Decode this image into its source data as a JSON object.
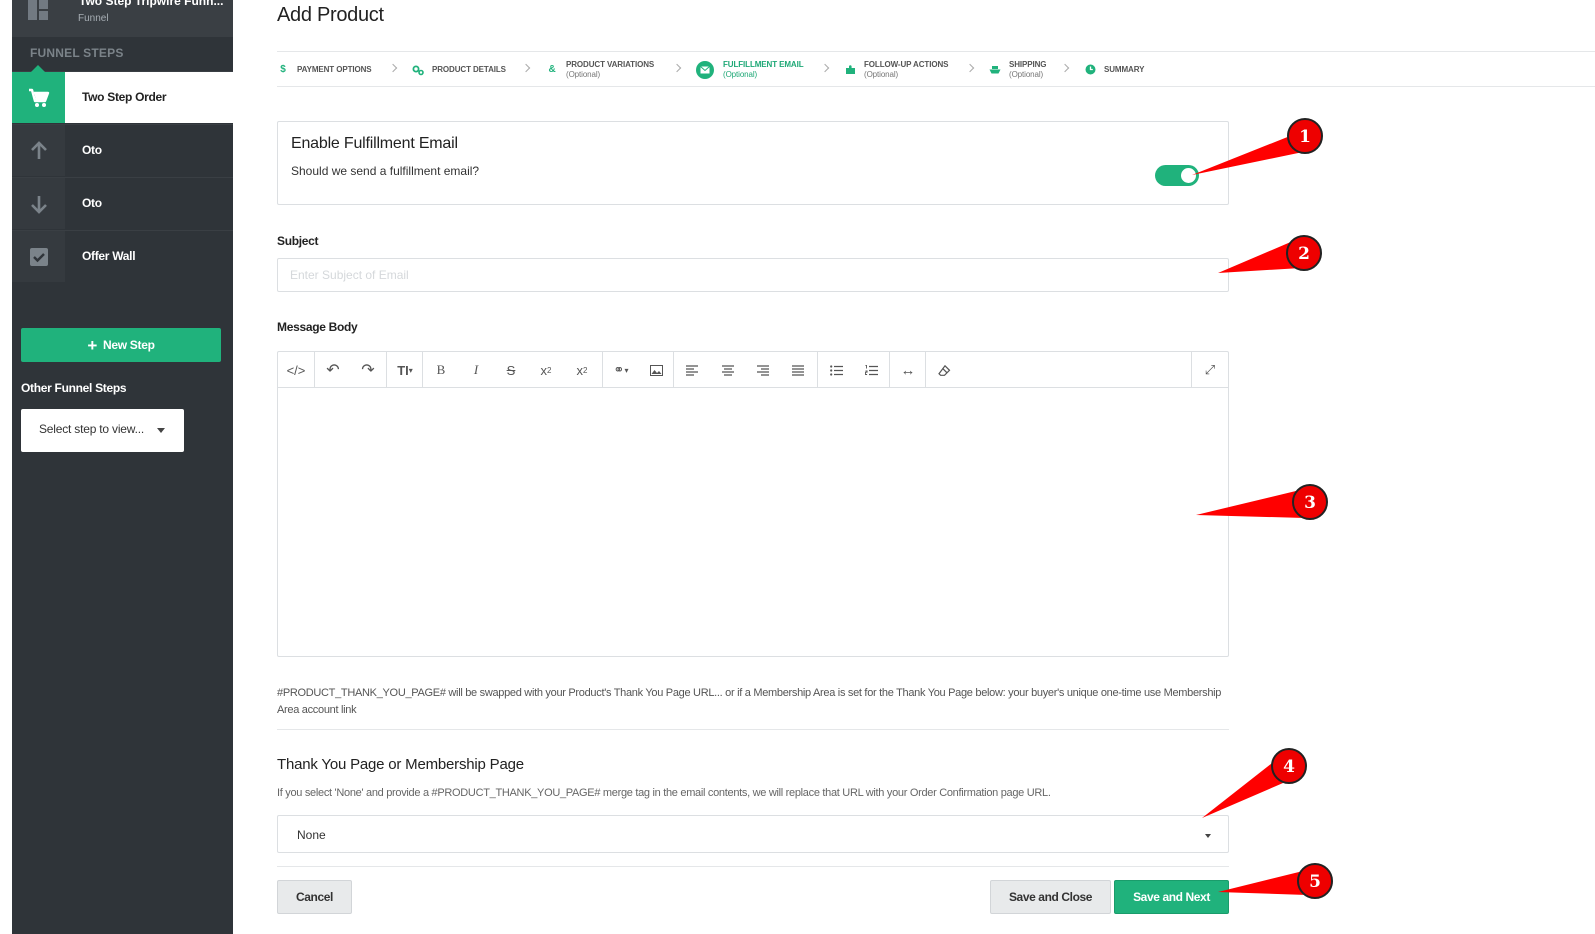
{
  "sidebar": {
    "funnel_title": "Two Step Tripwire Funn...",
    "funnel_subtitle": "Funnel",
    "steps_label": "FUNNEL STEPS",
    "steps": [
      {
        "label": "Two Step Order",
        "icon": "cart-icon",
        "active": true
      },
      {
        "label": "Oto",
        "icon": "arrow-up-icon",
        "active": false
      },
      {
        "label": "Oto",
        "icon": "arrow-down-icon",
        "active": false
      },
      {
        "label": "Offer Wall",
        "icon": "checkbox-icon",
        "active": false
      }
    ],
    "new_step_label": "New Step",
    "other_label": "Other Funnel Steps",
    "select_placeholder": "Select step to view..."
  },
  "page": {
    "title": "Add Product"
  },
  "wizard": [
    {
      "label": "PAYMENT OPTIONS",
      "optional": "",
      "icon": "dollar-icon"
    },
    {
      "label": "PRODUCT DETAILS",
      "optional": "",
      "icon": "gears-icon"
    },
    {
      "label": "PRODUCT VARIATIONS",
      "optional": "(Optional)",
      "icon": "variations-icon"
    },
    {
      "label": "FULFILLMENT EMAIL",
      "optional": "(Optional)",
      "icon": "envelope-icon",
      "active": true
    },
    {
      "label": "FOLLOW-UP ACTIONS",
      "optional": "(Optional)",
      "icon": "puzzle-icon"
    },
    {
      "label": "SHIPPING",
      "optional": "(Optional)",
      "icon": "ship-icon"
    },
    {
      "label": "SUMMARY",
      "optional": "",
      "icon": "clock-icon"
    }
  ],
  "fulfillment": {
    "heading": "Enable Fulfillment Email",
    "question": "Should we send a fulfillment email?",
    "enabled": true
  },
  "subject": {
    "label": "Subject",
    "placeholder": "Enter Subject of Email",
    "value": ""
  },
  "message": {
    "label": "Message Body",
    "toolbar": [
      "code-view",
      "undo",
      "redo",
      "font-size",
      "bold",
      "italic",
      "strikethrough",
      "superscript",
      "subscript",
      "link",
      "image",
      "align-left",
      "align-center",
      "align-right",
      "align-justify",
      "bullet-list",
      "numbered-list",
      "horizontal-rule",
      "clear-format",
      "fullscreen"
    ],
    "content": ""
  },
  "merge_help": "#PRODUCT_THANK_YOU_PAGE# will be swapped with your Product's Thank You Page URL... or if a Membership Area is set for the Thank You Page below: your buyer's unique one-time use Membership Area account link",
  "thank_you": {
    "heading": "Thank You Page or Membership Page",
    "help": "If you select 'None' and provide a #PRODUCT_THANK_YOU_PAGE# merge tag in the email contents, we will replace that URL with your Order Confirmation page URL.",
    "selected": "None"
  },
  "actions": {
    "cancel": "Cancel",
    "save_close": "Save and Close",
    "save_next": "Save and Next"
  },
  "annotations": [
    "1",
    "2",
    "3",
    "4",
    "5"
  ],
  "colors": {
    "accent": "#20b27c",
    "sidebar": "#2f3439",
    "annotation": "#ff0000"
  }
}
